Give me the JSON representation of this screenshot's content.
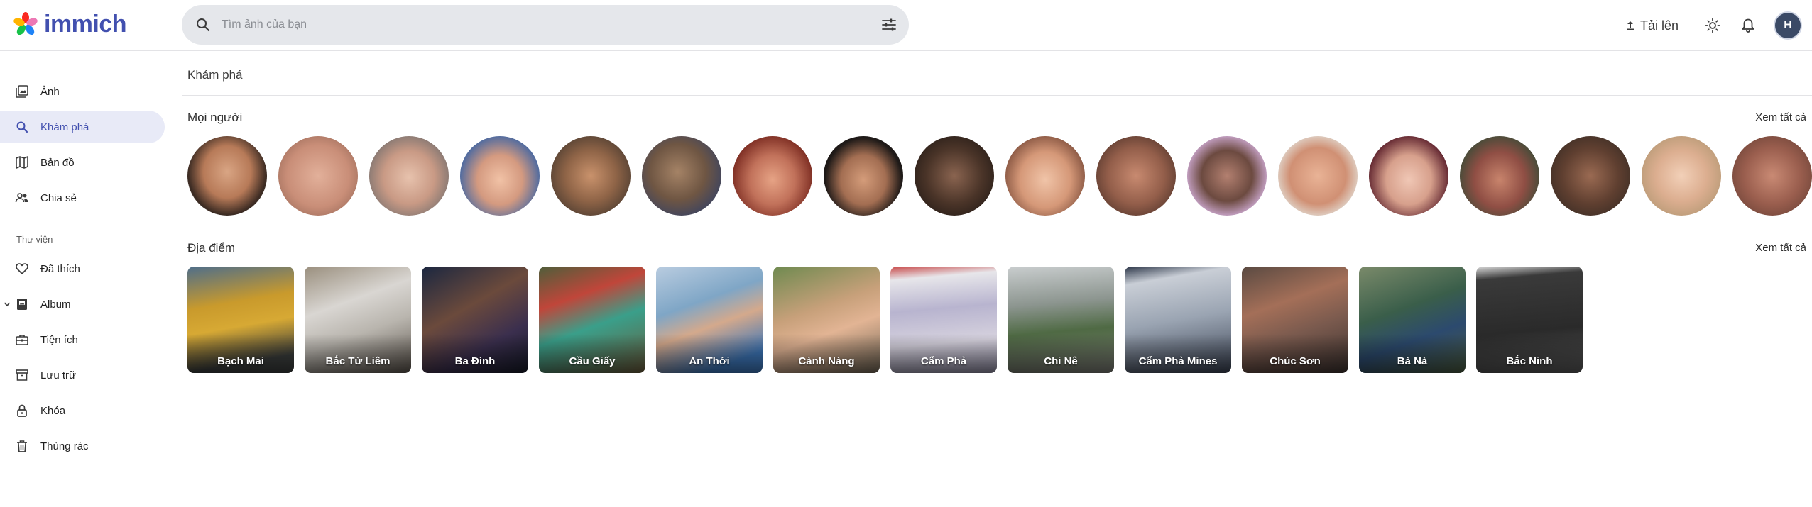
{
  "app": {
    "name": "immich"
  },
  "search": {
    "placeholder": "Tìm ảnh của bạn"
  },
  "header": {
    "upload_label": "Tải lên",
    "avatar_initial": "H"
  },
  "sidebar": {
    "items": [
      {
        "label": "Ảnh",
        "icon": "photos-icon"
      },
      {
        "label": "Khám phá",
        "icon": "search-icon",
        "active": true
      },
      {
        "label": "Bản đồ",
        "icon": "map-icon"
      },
      {
        "label": "Chia sẻ",
        "icon": "share-users-icon"
      }
    ],
    "library_heading": "Thư viện",
    "library_items": [
      {
        "label": "Đã thích",
        "icon": "heart-icon"
      },
      {
        "label": "Album",
        "icon": "album-icon"
      },
      {
        "label": "Tiện ích",
        "icon": "toolbox-icon"
      },
      {
        "label": "Lưu trữ",
        "icon": "archive-icon"
      },
      {
        "label": "Khóa",
        "icon": "lock-icon"
      },
      {
        "label": "Thùng rác",
        "icon": "trash-icon"
      }
    ]
  },
  "main": {
    "page_title": "Khám phá",
    "people": {
      "title": "Mọi người",
      "see_all": "Xem tất cả",
      "count": 18
    },
    "places": {
      "title": "Địa điểm",
      "see_all": "Xem tất cả",
      "items": [
        "Bạch Mai",
        "Bắc Từ Liêm",
        "Ba Đình",
        "Cầu Giấy",
        "An Thới",
        "Cành Nàng",
        "Cẩm Phả",
        "Chi Nê",
        "Cẩm Phả Mines",
        "Chúc Sơn",
        "Bà Nà",
        "Bắc Ninh"
      ]
    },
    "colors": {
      "accent": "#4250af",
      "active_bg": "#e8eaf7"
    }
  }
}
